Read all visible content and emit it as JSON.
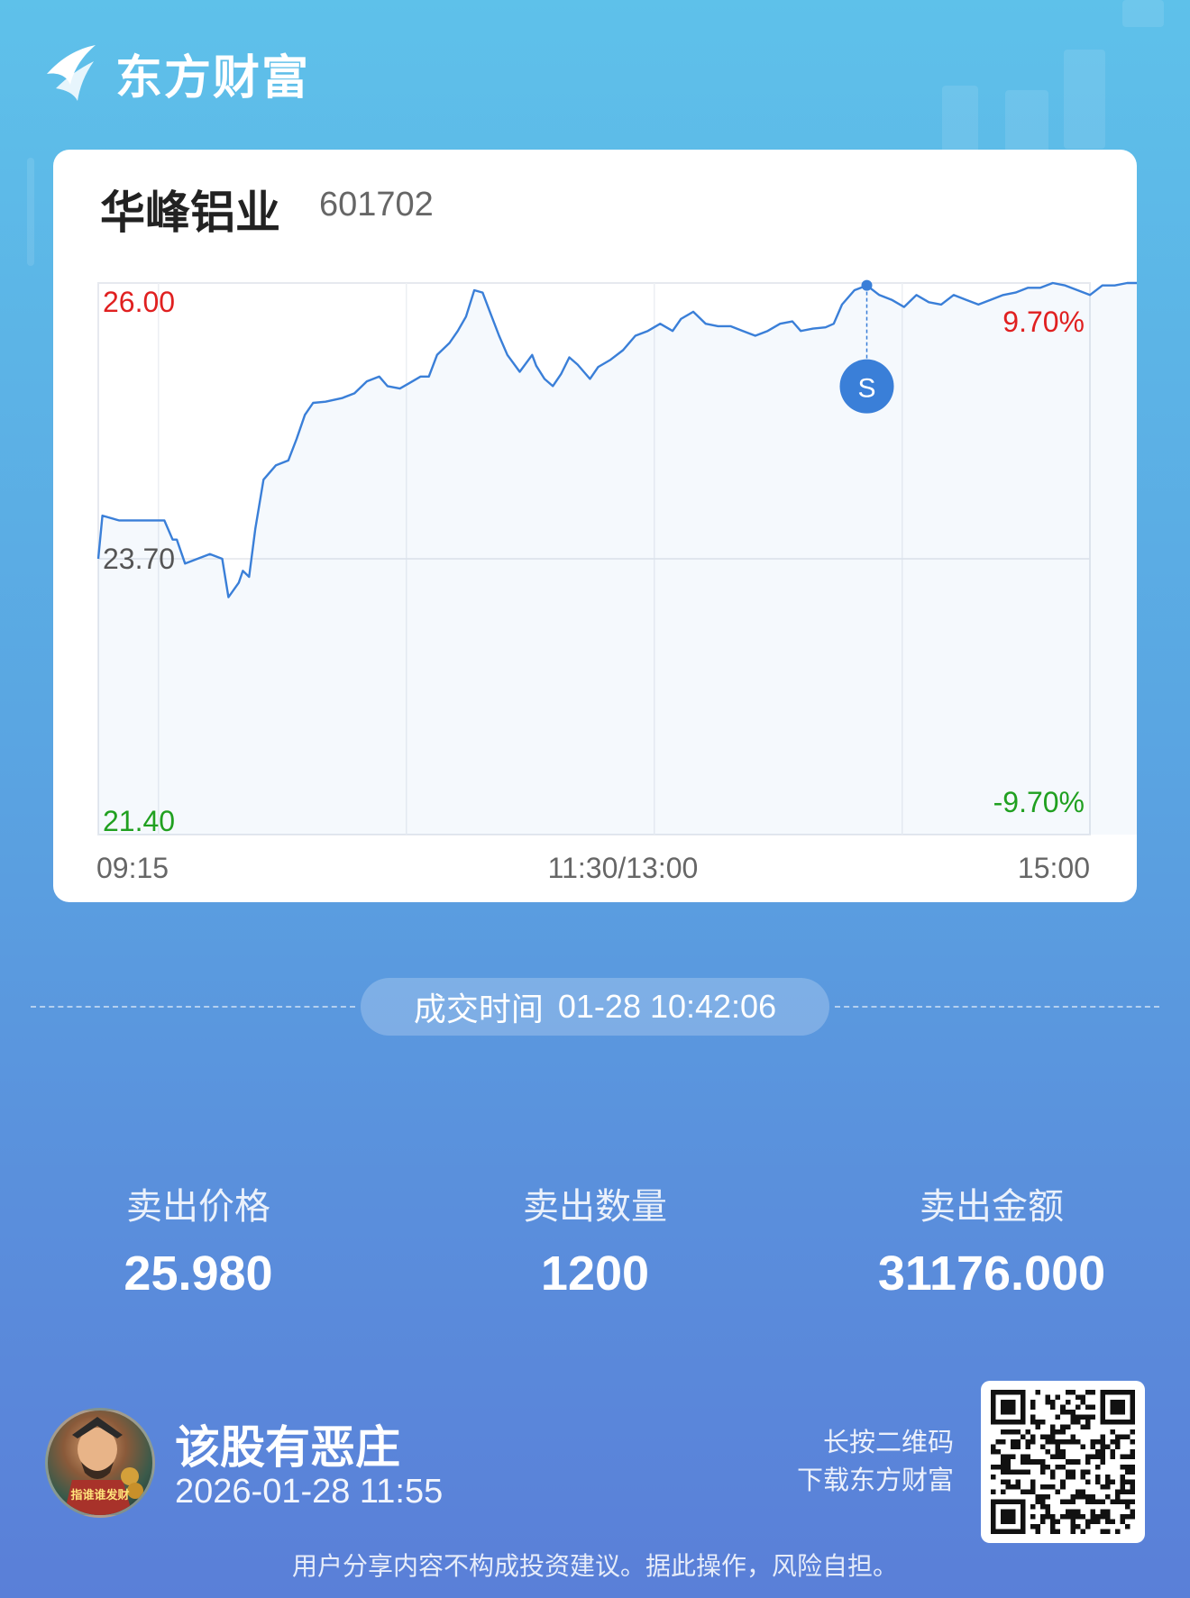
{
  "brand": {
    "name": "东方财富"
  },
  "stock": {
    "name": "华峰铝业",
    "code": "601702"
  },
  "chart_data": {
    "type": "line",
    "title": "",
    "xlabel": "",
    "ylabel": "",
    "ylim": [
      21.4,
      26.0
    ],
    "y_ticks_left": [
      "26.00",
      "23.70",
      "21.40"
    ],
    "y_ticks_right": [
      "9.70%",
      "-9.70%"
    ],
    "x_ticks": [
      "09:15",
      "11:30/13:00",
      "15:00"
    ],
    "prev_close": 23.7,
    "series": [
      {
        "values": [
          [
            0,
            23.7
          ],
          [
            2,
            24.06
          ],
          [
            10,
            24.02
          ],
          [
            32,
            24.02
          ],
          [
            36,
            23.86
          ],
          [
            38,
            23.86
          ],
          [
            42,
            23.66
          ],
          [
            48,
            23.7
          ],
          [
            54,
            23.74
          ],
          [
            60,
            23.7
          ],
          [
            63,
            23.38
          ],
          [
            68,
            23.5
          ],
          [
            70,
            23.6
          ],
          [
            73,
            23.55
          ],
          [
            76,
            23.95
          ],
          [
            80,
            24.36
          ],
          [
            86,
            24.48
          ],
          [
            92,
            24.52
          ],
          [
            96,
            24.7
          ],
          [
            100,
            24.9
          ],
          [
            104,
            25.0
          ],
          [
            110,
            25.01
          ],
          [
            118,
            25.04
          ],
          [
            124,
            25.08
          ],
          [
            130,
            25.18
          ],
          [
            136,
            25.22
          ],
          [
            140,
            25.14
          ],
          [
            146,
            25.12
          ],
          [
            150,
            25.16
          ],
          [
            156,
            25.22
          ],
          [
            160,
            25.22
          ],
          [
            164,
            25.4
          ],
          [
            170,
            25.5
          ],
          [
            174,
            25.6
          ],
          [
            178,
            25.72
          ],
          [
            182,
            25.94
          ],
          [
            186,
            25.92
          ],
          [
            190,
            25.74
          ],
          [
            194,
            25.56
          ],
          [
            198,
            25.4
          ],
          [
            204,
            25.26
          ],
          [
            210,
            25.4
          ],
          [
            212,
            25.31
          ],
          [
            216,
            25.2
          ],
          [
            220,
            25.14
          ],
          [
            224,
            25.24
          ],
          [
            228,
            25.38
          ],
          [
            232,
            25.32
          ],
          [
            238,
            25.2
          ],
          [
            242,
            25.3
          ],
          [
            248,
            25.36
          ],
          [
            254,
            25.44
          ],
          [
            260,
            25.56
          ],
          [
            266,
            25.6
          ],
          [
            272,
            25.66
          ],
          [
            278,
            25.6
          ],
          [
            282,
            25.7
          ],
          [
            288,
            25.76
          ],
          [
            294,
            25.66
          ],
          [
            300,
            25.64
          ],
          [
            306,
            25.64
          ],
          [
            312,
            25.6
          ],
          [
            318,
            25.56
          ],
          [
            324,
            25.6
          ],
          [
            330,
            25.66
          ],
          [
            336,
            25.68
          ],
          [
            340,
            25.6
          ],
          [
            346,
            25.62
          ],
          [
            352,
            25.63
          ],
          [
            356,
            25.66
          ],
          [
            360,
            25.82
          ],
          [
            366,
            25.94
          ],
          [
            372,
            25.98
          ],
          [
            378,
            25.9
          ],
          [
            384,
            25.86
          ],
          [
            390,
            25.8
          ],
          [
            396,
            25.9
          ],
          [
            402,
            25.84
          ],
          [
            408,
            25.82
          ],
          [
            414,
            25.9
          ],
          [
            420,
            25.86
          ],
          [
            426,
            25.82
          ],
          [
            432,
            25.86
          ],
          [
            438,
            25.9
          ],
          [
            444,
            25.92
          ],
          [
            450,
            25.96
          ],
          [
            456,
            25.96
          ],
          [
            462,
            26.0
          ],
          [
            468,
            25.98
          ],
          [
            474,
            25.94
          ],
          [
            480,
            25.9
          ],
          [
            486,
            25.98
          ],
          [
            492,
            25.98
          ],
          [
            498,
            26.0
          ],
          [
            504,
            26.0
          ],
          [
            510,
            25.98
          ],
          [
            516,
            26.0
          ],
          [
            522,
            25.98
          ],
          [
            528,
            25.96
          ],
          [
            534,
            25.92
          ],
          [
            540,
            25.88
          ],
          [
            546,
            25.88
          ],
          [
            550,
            25.94
          ],
          [
            556,
            25.98
          ],
          [
            562,
            25.98
          ]
        ]
      }
    ],
    "x_unit_note": "minutes",
    "marker": {
      "label": "S",
      "x": 372,
      "y": 25.98,
      "color": "#3a7fd8"
    },
    "line_color": "#3a7fd8",
    "up_color": "#e02020",
    "down_color": "#20a020",
    "grid": true
  },
  "trade": {
    "time_label": "成交时间",
    "time_value": "01-28 10:42:06"
  },
  "stats": [
    {
      "label": "卖出价格",
      "value": "25.980"
    },
    {
      "label": "卖出数量",
      "value": "1200"
    },
    {
      "label": "卖出金额",
      "value": "31176.000"
    }
  ],
  "user": {
    "avatar_caption": "指谁谁发财",
    "title": "该股有恶庄",
    "time": "2026-01-28 11:55"
  },
  "qr": {
    "hint_line1": "长按二维码",
    "hint_line2": "下载东方财富"
  },
  "disclaimer": "用户分享内容不构成投资建议。据此操作，风险自担。"
}
